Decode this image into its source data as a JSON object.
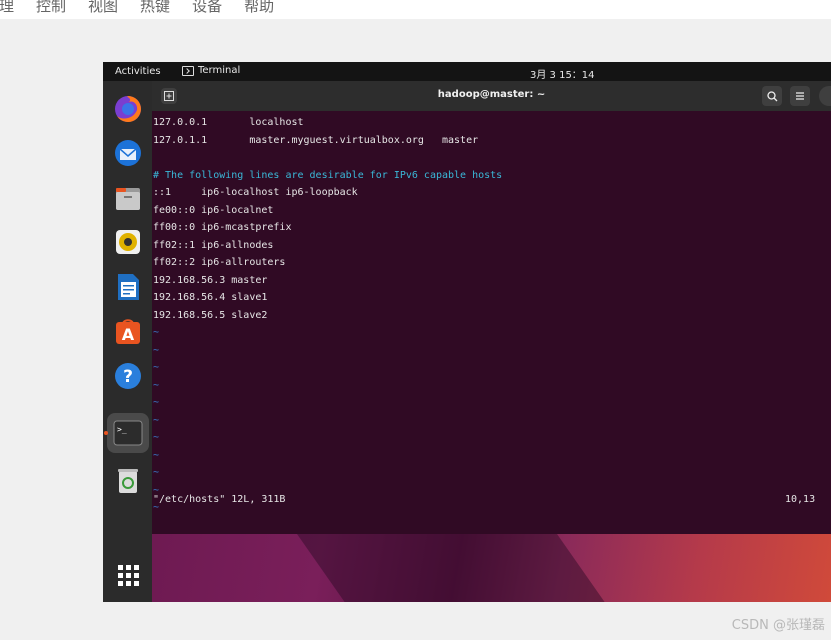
{
  "host_menu": [
    "理",
    "控制",
    "视图",
    "热键",
    "设备",
    "帮助"
  ],
  "topbar": {
    "activities": "Activities",
    "app_name": "Terminal",
    "clock": "3月 3 15：14"
  },
  "terminal": {
    "title": "hadoop@master: ~",
    "lines": [
      {
        "text": "127.0.0.1       localhost",
        "kind": "normal"
      },
      {
        "text": "127.0.1.1       master.myguest.virtualbox.org   master",
        "kind": "normal"
      },
      {
        "text": "",
        "kind": "normal"
      },
      {
        "text": "# The following lines are desirable for IPv6 capable hosts",
        "kind": "comment"
      },
      {
        "text": "::1     ip6-localhost ip6-loopback",
        "kind": "normal"
      },
      {
        "text": "fe00::0 ip6-localnet",
        "kind": "normal"
      },
      {
        "text": "ff00::0 ip6-mcastprefix",
        "kind": "normal"
      },
      {
        "text": "ff02::1 ip6-allnodes",
        "kind": "normal"
      },
      {
        "text": "ff02::2 ip6-allrouters",
        "kind": "normal"
      },
      {
        "text": "192.168.56.3 master",
        "kind": "normal"
      },
      {
        "text": "192.168.56.4 slave1",
        "kind": "normal"
      },
      {
        "text": "192.168.56.5 slave2",
        "kind": "normal"
      },
      {
        "text": "~",
        "kind": "tilde"
      },
      {
        "text": "~",
        "kind": "tilde"
      },
      {
        "text": "~",
        "kind": "tilde"
      },
      {
        "text": "~",
        "kind": "tilde"
      },
      {
        "text": "~",
        "kind": "tilde"
      },
      {
        "text": "~",
        "kind": "tilde"
      },
      {
        "text": "~",
        "kind": "tilde"
      },
      {
        "text": "~",
        "kind": "tilde"
      },
      {
        "text": "~",
        "kind": "tilde"
      },
      {
        "text": "~",
        "kind": "tilde"
      },
      {
        "text": "~",
        "kind": "tilde"
      }
    ],
    "status_file": "\"/etc/hosts\" 12L, 311B",
    "cursor_pos": "10,13"
  },
  "dock": {
    "items": [
      "firefox-icon",
      "thunderbird-icon",
      "files-icon",
      "rhythmbox-icon",
      "writer-icon",
      "software-icon",
      "help-icon",
      "terminal-icon",
      "trash-icon"
    ],
    "active_item": "terminal-icon"
  },
  "watermark": "CSDN @张瑾磊",
  "colors": {
    "terminal_bg": "#300a24",
    "comment": "#3ab8d8",
    "tilde": "#3a7fd0",
    "accent": "#e95420"
  }
}
